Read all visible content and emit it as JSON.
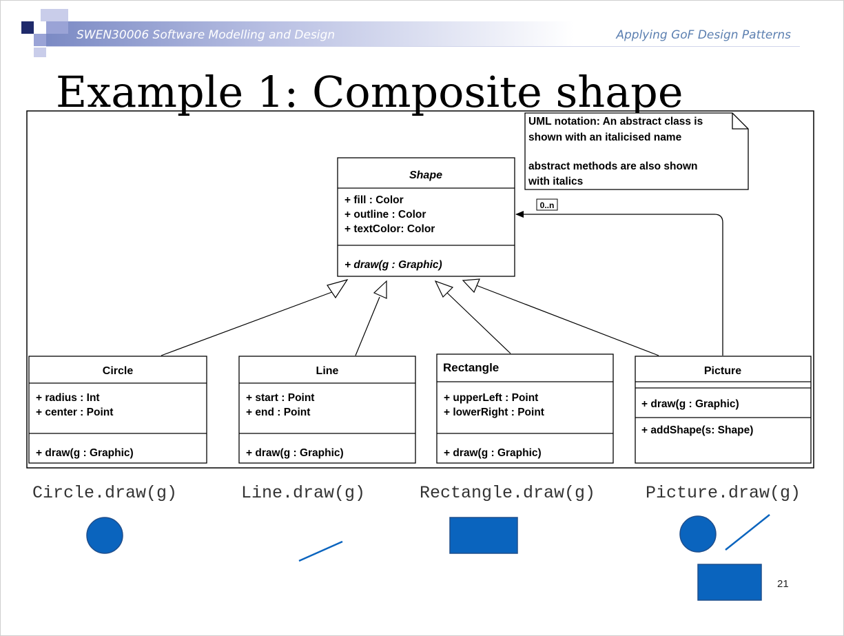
{
  "header": {
    "course": "SWEN30006 Software Modelling and Design",
    "topic": "Applying GoF Design Patterns"
  },
  "slide": {
    "title": "Example 1: Composite shape",
    "page_number": "21"
  },
  "uml": {
    "note": {
      "lines": [
        "UML notation: An abstract class is",
        "shown with an italicised name",
        "",
        "abstract methods are also shown",
        "with italics"
      ]
    },
    "multiplicity": "0..n",
    "shape": {
      "name": "Shape",
      "attributes": [
        "+ fill : Color",
        "+ outline : Color",
        "+ textColor: Color"
      ],
      "methods": [
        "+ draw(g : Graphic)"
      ]
    },
    "circle": {
      "name": "Circle",
      "attributes": [
        "+ radius : Int",
        "+ center : Point"
      ],
      "methods": [
        "+ draw(g : Graphic)"
      ]
    },
    "line": {
      "name": "Line",
      "attributes": [
        "+ start : Point",
        "+ end : Point"
      ],
      "methods": [
        "+ draw(g : Graphic)"
      ]
    },
    "rectangle": {
      "name": "Rectangle",
      "attributes": [
        "+ upperLeft : Point",
        "+ lowerRight : Point"
      ],
      "methods": [
        "+ draw(g : Graphic)"
      ]
    },
    "picture": {
      "name": "Picture",
      "methods": [
        "+ draw(g : Graphic)",
        "+ addShape(s: Shape)"
      ]
    }
  },
  "examples": [
    {
      "label": "Circle.draw(g)"
    },
    {
      "label": "Line.draw(g)"
    },
    {
      "label": "Rectangle.draw(g)"
    },
    {
      "label": "Picture.draw(g)"
    }
  ],
  "colors": {
    "shape_fill": "#0a64be",
    "shape_stroke": "#1f4e8c",
    "header_blue": "#5b7fb0",
    "logo_navy": "#1f2a6b",
    "logo_lavender": "#9aa3d6"
  }
}
